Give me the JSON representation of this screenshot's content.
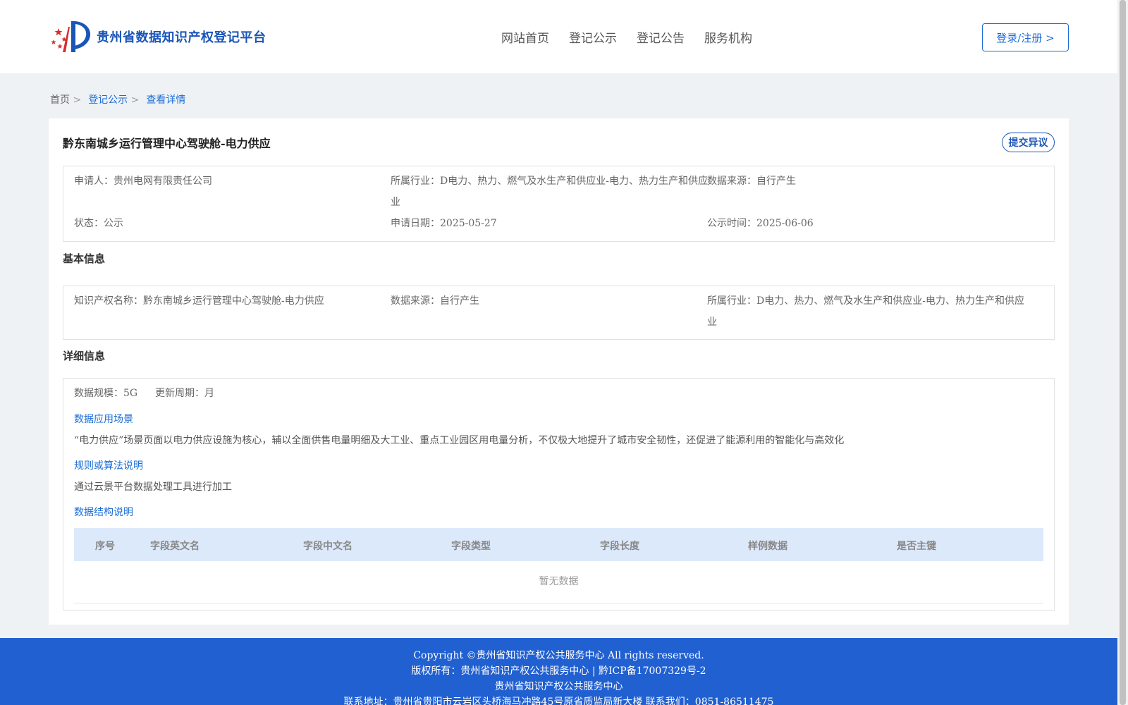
{
  "header": {
    "site_title": "贵州省数据知识产权登记平台",
    "nav": [
      "网站首页",
      "登记公示",
      "登记公告",
      "服务机构"
    ],
    "login_label": "登录/注册 >"
  },
  "breadcrumb": [
    "首页",
    "登记公示",
    "查看详情"
  ],
  "detail": {
    "title": "黔东南城乡运行管理中心驾驶舱-电力供应",
    "objection_label": "提交异议",
    "summary": {
      "applicant_label": "申请人：",
      "applicant": "贵州电网有限责任公司",
      "industry_label": "所属行业：",
      "industry": "D电力、热力、燃气及水生产和供应业-电力、热力生产和供应业",
      "source_label": "数据来源：",
      "source": "自行产生",
      "status_label": "状态：",
      "status": "公示",
      "apply_date_label": "申请日期：",
      "apply_date": "2025-05-27",
      "publish_time_label": "公示时间：",
      "publish_time": "2025-06-06"
    },
    "basic": {
      "section_title": "基本信息",
      "ip_name_label": "知识产权名称：",
      "ip_name": "黔东南城乡运行管理中心驾驶舱-电力供应",
      "source_label": "数据来源：",
      "source": "自行产生",
      "industry_label": "所属行业：",
      "industry": "D电力、热力、燃气及水生产和供应业-电力、热力生产和供应业"
    },
    "more": {
      "section_title": "详细信息",
      "scale_label": "数据规模：",
      "scale": "5G",
      "cycle_label": "更新周期：",
      "cycle": "月",
      "scenario_title": "数据应用场景",
      "scenario_text": "“电力供应”场景页面以电力供应设施为核心，辅以全面供售电量明细及大工业、重点工业园区用电量分析，不仅极大地提升了城市安全韧性，还促进了能源利用的智能化与高效化",
      "rule_title": "规则或算法说明",
      "rule_text": "通过云景平台数据处理工具进行加工",
      "structure_title": "数据结构说明",
      "table_headers": [
        "序号",
        "字段英文名",
        "字段中文名",
        "字段类型",
        "字段长度",
        "样例数据",
        "是否主键"
      ],
      "empty_text": "暂无数据"
    }
  },
  "footer": {
    "copyright": "Copyright ©贵州省知识产权公共服务中心 All rights reserved.",
    "owner": "版权所有：贵州省知识产权公共服务中心 | 黔ICP备17007329号-2",
    "org": "贵州省知识产权公共服务中心",
    "address": "联系地址：贵州省贵阳市云岩区头桥海马冲路45号原省质监局新大楼 联系我们：0851-86511475"
  },
  "colors": {
    "brand": "#1a55b8",
    "link": "#1a6bd6",
    "footer_bg": "#2160d0",
    "table_head_bg": "#dce9fb",
    "page_bg": "#eef2f5"
  }
}
